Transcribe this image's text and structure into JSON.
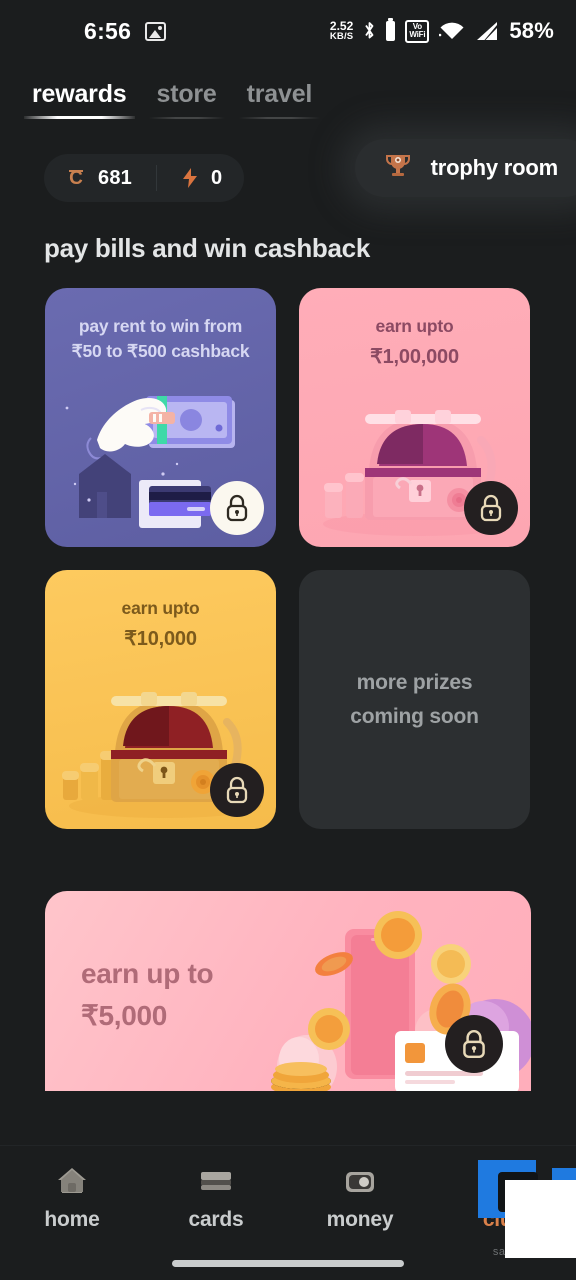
{
  "statusbar": {
    "time": "6:56",
    "image_icon": "image-icon",
    "network_speed": "2.52",
    "network_unit": "KB/S",
    "bluetooth_icon": "bluetooth-icon",
    "battery_icon": "battery-icon",
    "vowifi_line1": "Vo",
    "vowifi_line2": "WiFi",
    "wifi_icon": "wifi-icon",
    "signal_icon": "signal-icon",
    "battery_percent": "58%"
  },
  "tabs": [
    {
      "label": "rewards",
      "active": true
    },
    {
      "label": "store",
      "active": false
    },
    {
      "label": "travel",
      "active": false
    }
  ],
  "stats": {
    "coin_icon": "cred-coin-icon",
    "coin_value": "681",
    "bolt_icon": "lightning-bolt-icon",
    "bolt_value": "0"
  },
  "trophy": {
    "icon": "trophy-icon",
    "label": "trophy room"
  },
  "section": {
    "title": "pay bills and win cashback"
  },
  "cards": [
    {
      "id": "pay-rent",
      "line1": "pay rent to win from",
      "line2": "₹50 to ₹500 cashback",
      "lock_icon": "lock-icon",
      "lock_style": "light",
      "color": "#6a6bb0"
    },
    {
      "id": "earn-1-lakh",
      "line1": "earn upto",
      "line2": "₹1,00,000",
      "lock_icon": "lock-icon",
      "lock_style": "dark",
      "color": "#ffadb8"
    },
    {
      "id": "earn-10k",
      "line1": "earn upto",
      "line2": "₹10,000",
      "lock_icon": "lock-icon",
      "lock_style": "dark",
      "color": "#fdca5f"
    },
    {
      "id": "coming-soon",
      "line1": "more prizes",
      "line2": "coming soon",
      "color": "#2c2f31"
    }
  ],
  "banner": {
    "line1": "earn up to",
    "line2": "₹5,000",
    "lock_icon": "lock-icon",
    "lock_style": "dark",
    "color": "#ffb3bf"
  },
  "bottom_nav": [
    {
      "label": "home",
      "icon": "house-icon",
      "active": false,
      "sub": ""
    },
    {
      "label": "cards",
      "icon": "credit-card-icon",
      "active": false,
      "sub": ""
    },
    {
      "label": "money",
      "icon": "wallet-icon",
      "active": false,
      "sub": ""
    },
    {
      "label": "club",
      "icon": "bag-icon",
      "active": true,
      "sub": "sale"
    }
  ],
  "colors": {
    "accent_orange": "#d9804a",
    "background": "#1b1d1e",
    "card_purple": "#6a6bb0",
    "card_pink": "#ffadb8",
    "card_yellow": "#fdca5f",
    "banner_pink": "#ffb3bf"
  }
}
